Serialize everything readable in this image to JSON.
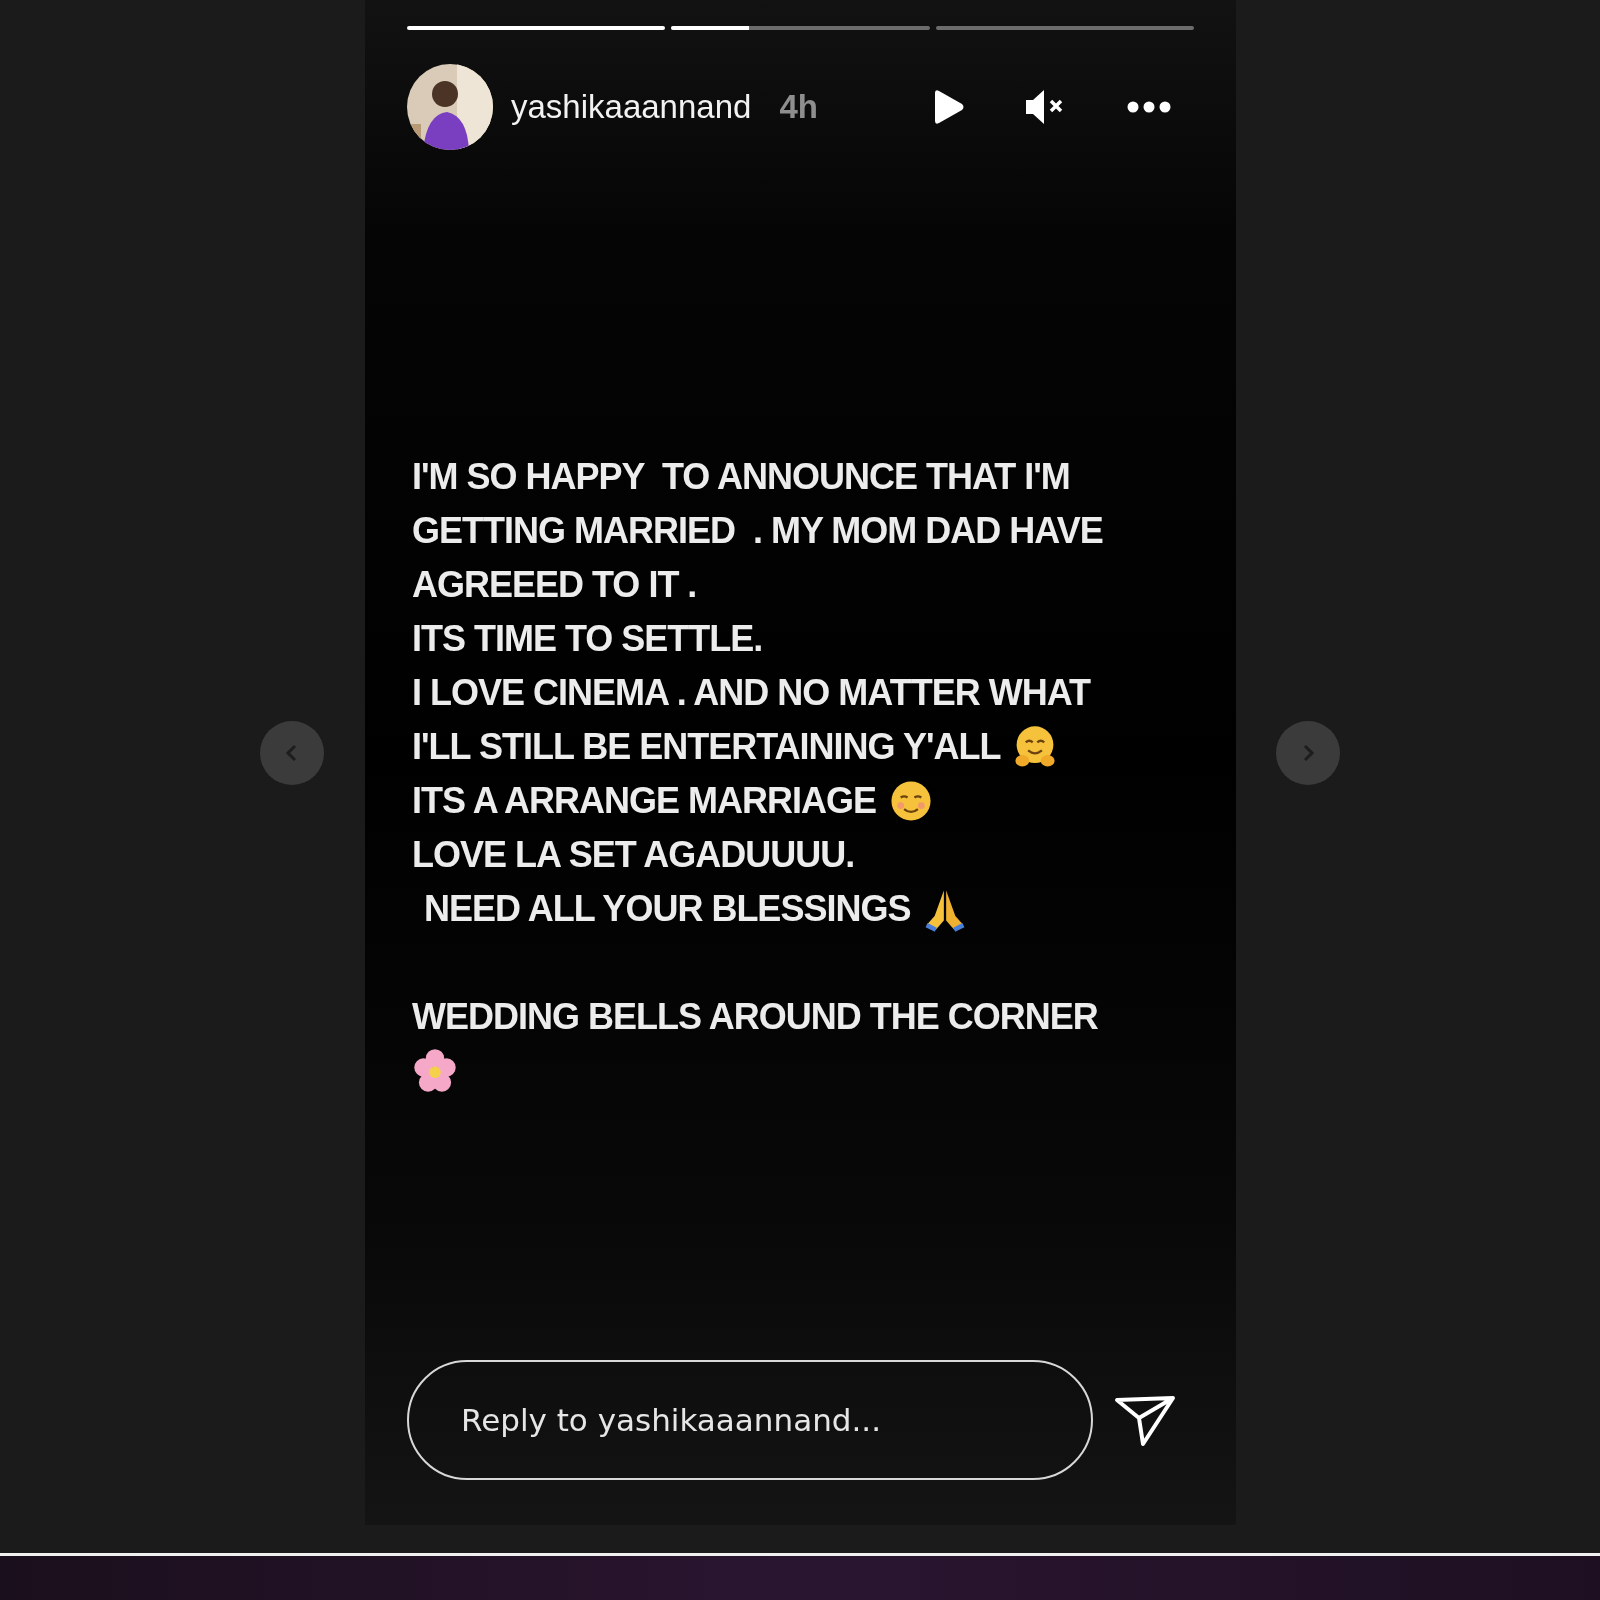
{
  "story": {
    "progress": [
      {
        "level": 1
      },
      {
        "level": 0.3
      },
      {
        "level": 0
      }
    ],
    "header": {
      "username": "yashikaaannand",
      "time": "4h",
      "playing": false,
      "muted": true
    },
    "lines": [
      {
        "kind": "text",
        "text": "I'M SO HAPPY  TO ANNOUNCE THAT I'M"
      },
      {
        "kind": "text",
        "text": "GETTING MARRIED  . MY MOM DAD HAVE"
      },
      {
        "kind": "text",
        "text": "AGREEED TO IT ."
      },
      {
        "kind": "text",
        "text": "ITS TIME TO SETTLE."
      },
      {
        "kind": "text",
        "text": "I LOVE CINEMA . AND NO MATTER WHAT"
      },
      {
        "kind": "text",
        "text": "I'LL STILL BE ENTERTAINING Y'ALL",
        "emoji": {
          "kind": "hug"
        }
      },
      {
        "kind": "text",
        "text": "ITS A ARRANGE MARRIAGE",
        "emoji": {
          "kind": "smile"
        }
      },
      {
        "kind": "text",
        "text": "LOVE LA SET AGADUUUU."
      },
      {
        "kind": "text",
        "text": "NEED ALL YOUR BLESSINGS",
        "emoji": {
          "kind": "pray"
        },
        "indented": true
      },
      {
        "kind": "blank"
      },
      {
        "kind": "text",
        "text": "WEDDING BELLS AROUND THE CORNER"
      },
      {
        "kind": "emoji",
        "emoji": {
          "kind": "flower"
        }
      }
    ],
    "reply": {
      "placeholder": "Reply to yashikaaannand..."
    }
  }
}
